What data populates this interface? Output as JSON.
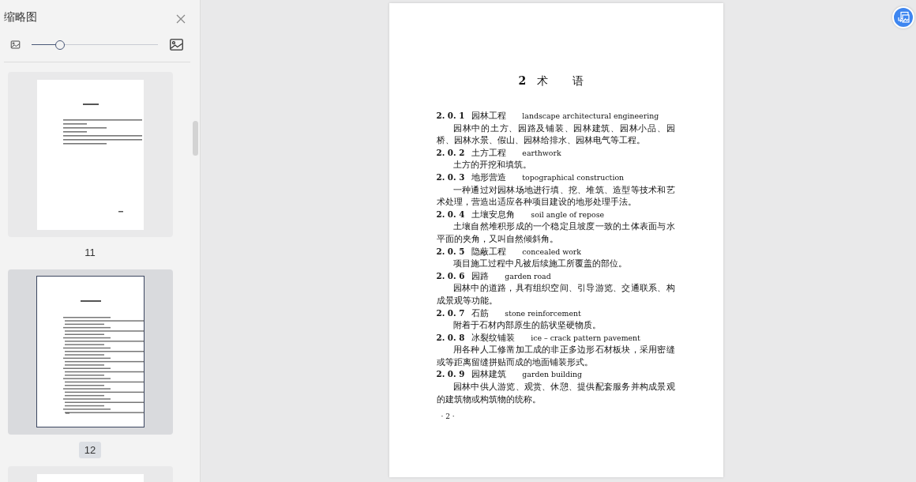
{
  "sidebar": {
    "title": "缩略图",
    "zoom_slider": {
      "level": 0.225
    },
    "thumbnails": [
      {
        "label": "11",
        "selected": false
      },
      {
        "label": "12",
        "selected": true
      },
      {
        "selected": false
      }
    ]
  },
  "document": {
    "heading": {
      "number": "2",
      "title": "术　语"
    },
    "terms": [
      {
        "number": "2. 0. 1",
        "term": "园林工程",
        "english": "landscape architectural engineering",
        "definition": "园林中的土方、园路及铺装、园林建筑、园林小品、园桥、园林水景、假山、园林给排水、园林电气等工程。"
      },
      {
        "number": "2. 0. 2",
        "term": "土方工程",
        "english": "earthwork",
        "definition": "土方的开挖和填筑。"
      },
      {
        "number": "2. 0. 3",
        "term": "地形营造",
        "english": "topographical construction",
        "definition": "一种通过对园林场地进行填、挖、堆筑、造型等技术和艺术处理，营造出适应各种项目建设的地形处理手法。"
      },
      {
        "number": "2. 0. 4",
        "term": "土壤安息角",
        "english": "soil angle of repose",
        "definition": "土壤自然堆积形成的一个稳定且坡度一致的土体表面与水平面的夹角，又叫自然倾斜角。"
      },
      {
        "number": "2. 0. 5",
        "term": "隐蔽工程",
        "english": "concealed work",
        "definition": "项目施工过程中凡被后续施工所覆盖的部位。"
      },
      {
        "number": "2. 0. 6",
        "term": "园路",
        "english": "garden road",
        "definition": "园林中的道路，具有组织空间、引导游览、交通联系、构成景观等功能。"
      },
      {
        "number": "2. 0. 7",
        "term": "石筋",
        "english": "stone reinforcement",
        "definition": "附着于石材内部原生的筋状坚硬物质。"
      },
      {
        "number": "2. 0. 8",
        "term": "冰裂纹铺装",
        "english": "ice – crack pattern pavement",
        "definition": "用各种人工修凿加工成的非正多边形石材板块，采用密缝或等距离留缝拼贴而成的地面铺装形式。"
      },
      {
        "number": "2. 0. 9",
        "term": "园林建筑",
        "english": "garden building",
        "definition": "园林中供人游览、观赏、休憩、提供配套服务并构成景观的建筑物或构筑物的统称。"
      }
    ],
    "page_number": "· 2 ·"
  }
}
